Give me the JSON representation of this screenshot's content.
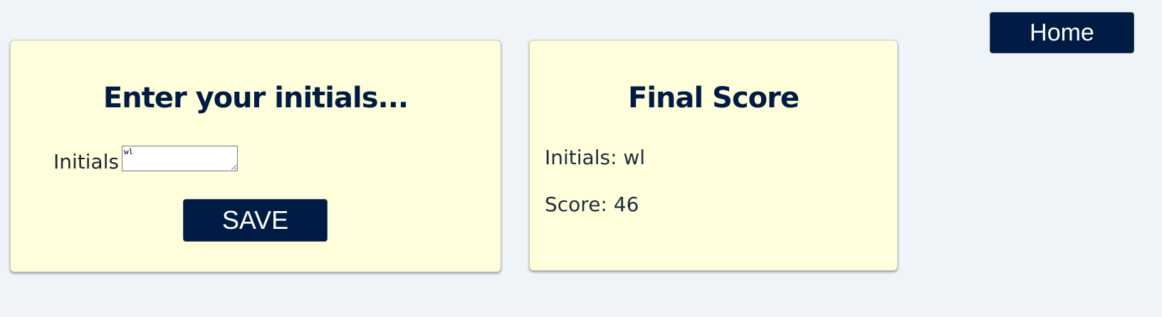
{
  "header": {
    "home_label": "Home"
  },
  "initials_card": {
    "title": "Enter your initials...",
    "label": "Initials",
    "input_value": "wl",
    "save_label": "SAVE"
  },
  "score_card": {
    "title": "Final Score",
    "initials_line": "Initials: wl",
    "score_line": "Score: 46"
  },
  "colors": {
    "background": "#eff4f8",
    "card_background": "#ffffdc",
    "button_background": "#001c44",
    "heading_text": "#001c44"
  }
}
